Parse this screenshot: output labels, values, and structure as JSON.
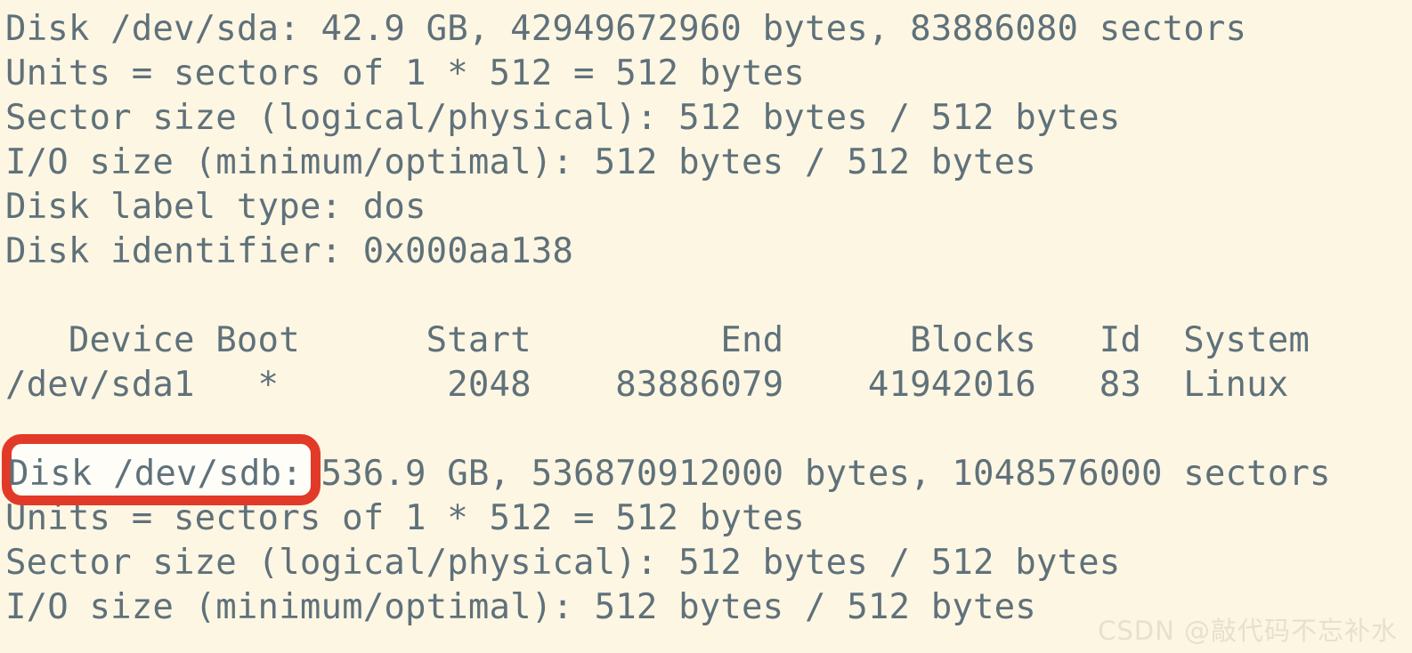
{
  "terminal": {
    "background_color": "#fdf6e3",
    "text_color": "#5f717a",
    "lines": [
      "Disk /dev/sda: 42.9 GB, 42949672960 bytes, 83886080 sectors",
      "Units = sectors of 1 * 512 = 512 bytes",
      "Sector size (logical/physical): 512 bytes / 512 bytes",
      "I/O size (minimum/optimal): 512 bytes / 512 bytes",
      "Disk label type: dos",
      "Disk identifier: 0x000aa138",
      "",
      "   Device Boot      Start         End      Blocks   Id  System",
      "/dev/sda1   *        2048    83886079    41942016   83  Linux",
      "",
      "Disk /dev/sdb: 536.9 GB, 536870912000 bytes, 1048576000 sectors",
      "Units = sectors of 1 * 512 = 512 bytes",
      "Sector size (logical/physical): 512 bytes / 512 bytes",
      "I/O size (minimum/optimal): 512 bytes / 512 bytes"
    ],
    "disk_sda": {
      "device": "/dev/sda",
      "size_human": "42.9 GB",
      "size_bytes": "42949672960",
      "sectors": "83886080",
      "units": "sectors of 1 * 512 = 512 bytes",
      "sector_size_logical": "512 bytes",
      "sector_size_physical": "512 bytes",
      "io_size_minimum": "512 bytes",
      "io_size_optimal": "512 bytes",
      "disk_label_type": "dos",
      "disk_identifier": "0x000aa138"
    },
    "partition_table": {
      "headers": [
        "Device",
        "Boot",
        "Start",
        "End",
        "Blocks",
        "Id",
        "System"
      ],
      "rows": [
        {
          "device": "/dev/sda1",
          "boot": "*",
          "start": "2048",
          "end": "83886079",
          "blocks": "41942016",
          "id": "83",
          "system": "Linux"
        }
      ]
    },
    "disk_sdb": {
      "device": "/dev/sdb",
      "size_human": "536.9 GB",
      "size_bytes": "536870912000",
      "sectors": "1048576000",
      "units": "sectors of 1 * 512 = 512 bytes",
      "sector_size_logical": "512 bytes",
      "sector_size_physical": "512 bytes",
      "io_size_minimum": "512 bytes",
      "io_size_optimal": "512 bytes"
    }
  },
  "annotation": {
    "highlight_color": "#e23a28",
    "highlight_label": "Disk /dev/sdb:"
  },
  "watermark": {
    "text": "CSDN @敲代码不忘补水",
    "color": "#e8e0cd"
  }
}
